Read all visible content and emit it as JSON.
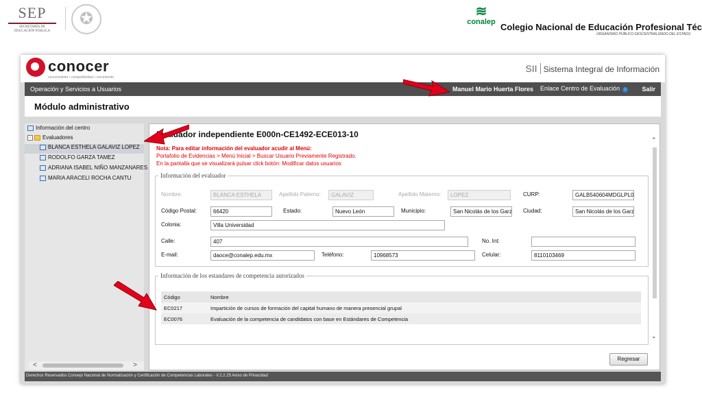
{
  "slide_header": {
    "sep": {
      "title": "SEP",
      "line1": "SECRETARÍA DE",
      "line2": "EDUCACIÓN PÚBLICA"
    },
    "conalep": {
      "logo_text": "conalep",
      "title": "Colegio Nacional de Educación Profesional Técnica",
      "subtitle": "ORGANISMO PÚBLICO DESCENTRALIZADO DEL ESTADO"
    }
  },
  "app": {
    "logo": {
      "name": "conocer",
      "tagline": "conocimiento • competitividad • crecimiento"
    },
    "system_short": "SII",
    "system_name": "Sistema Integral de Información",
    "nav": {
      "left_link": "Operación y Servicios a Usuarios",
      "user": "Manuel Mario Huerta Flores",
      "center_link": "Enlace Centro de Evaluación",
      "logout": "Salir"
    },
    "module_title": "Módulo administrativo"
  },
  "tree": {
    "items": [
      {
        "label": "Información del centro",
        "icon": "document-icon"
      },
      {
        "label": "Evaluadores",
        "icon": "folder-icon",
        "expander": "-"
      },
      {
        "label": "BLANCA ESTHELA GALAVIZ LOPEZ",
        "icon": "document-icon",
        "selected": true
      },
      {
        "label": "RODOLFO GARZA TAMEZ",
        "icon": "document-icon"
      },
      {
        "label": "ADRIANA ISABEL NIÑO MANZANARES",
        "icon": "document-icon"
      },
      {
        "label": "MARIA ARACELI ROCHA CANTU",
        "icon": "document-icon"
      }
    ],
    "scroll_left": "<",
    "scroll_right": ">"
  },
  "panel": {
    "title": "Evaluador independiente E000n-CE1492-ECE013-10",
    "note": {
      "line1": "Nota: Para editar información del evaluador acudir al Menú:",
      "line2": "Portafolio de Evidencias > Menú Inicial > Buscar Usuario Previamente Registrado.",
      "line3": "En la pantalla que se visualizará pulsar click botón: Modificar datos usuarios"
    },
    "evaluator_info": {
      "legend": "Información del evaluador",
      "nombre_label": "Nombre:",
      "nombre": "BLANCA ESTHELA",
      "paterno_label": "Apellido Paterno:",
      "paterno": "GALAVIZ",
      "materno_label": "Apellido Materno:",
      "materno": "LOPEZ",
      "curp_label": "CURP:",
      "curp": "GALB540604MDGLPL0",
      "cp_label": "Código Postal:",
      "cp": "66420",
      "estado_label": "Estado:",
      "estado": "Nuevo León",
      "municipio_label": "Municipio:",
      "municipio": "San Nicolás de los Garza",
      "ciudad_label": "Ciudad:",
      "ciudad": "San Nicolás de los Garza",
      "colonia_label": "Colonia:",
      "colonia": "Villa Universidad",
      "calle_label": "Calle:",
      "calle": "407",
      "noint_label": "No. Int:",
      "noint": "",
      "email_label": "E-mail:",
      "email": "daoce@conalep.edu.mx",
      "telefono_label": "Teléfono:",
      "telefono": "10968573",
      "celular_label": "Celular:",
      "celular": "8110103469"
    },
    "standards": {
      "legend": "Información de los estandares de competencia autorizados",
      "headers": [
        "Código",
        "Nombre"
      ],
      "rows": [
        [
          "EC0217",
          "Impartición de cursos de formación del capital humano de manera presencial grupal"
        ],
        [
          "EC0076",
          "Evaluación de la competencia de candidatos con base en Estándares de Competencia"
        ]
      ]
    },
    "back_button": "Regresar"
  },
  "footer": "Derechos Reservados Consejo Nacional de Normalización y Certificación de Competencias Laborales - V.2.2.25 Aviso de Privacidad",
  "annotation_color": "#e3001b"
}
